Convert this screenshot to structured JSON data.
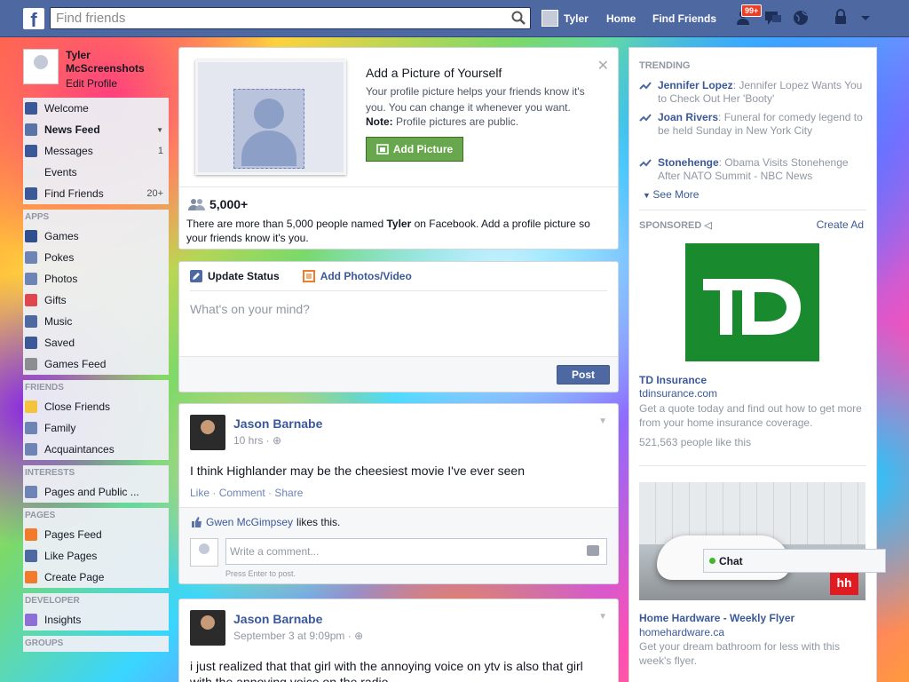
{
  "topbar": {
    "search_placeholder": "Find friends",
    "user_name": "Tyler",
    "home": "Home",
    "find_friends": "Find Friends",
    "notif_badge": "99+"
  },
  "left": {
    "profile_name": "Tyler McScreenshots",
    "edit_profile": "Edit Profile",
    "main": [
      {
        "label": "Welcome",
        "count": "",
        "color": "#3b5998"
      },
      {
        "label": "News Feed",
        "count": "",
        "color": "#5b74a8"
      },
      {
        "label": "Messages",
        "count": "1",
        "color": "#3b5998"
      },
      {
        "label": "Events",
        "count": "",
        "color": "#e9eaed"
      },
      {
        "label": "Find Friends",
        "count": "20+",
        "color": "#3b5998"
      }
    ],
    "apps_head": "APPS",
    "apps": [
      {
        "label": "Games",
        "color": "#2f4f8f"
      },
      {
        "label": "Pokes",
        "color": "#6d84b4"
      },
      {
        "label": "Photos",
        "color": "#6d84b4"
      },
      {
        "label": "Gifts",
        "color": "#e0464e"
      },
      {
        "label": "Music",
        "color": "#4e69a2"
      },
      {
        "label": "Saved",
        "color": "#3b5998"
      },
      {
        "label": "Games Feed",
        "color": "#8b8d91"
      }
    ],
    "friends_head": "FRIENDS",
    "friends": [
      {
        "label": "Close Friends",
        "color": "#f5c33b"
      },
      {
        "label": "Family",
        "color": "#6d84b4"
      },
      {
        "label": "Acquaintances",
        "color": "#6d84b4"
      }
    ],
    "interests_head": "INTERESTS",
    "interests": [
      {
        "label": "Pages and Public ...",
        "color": "#6d84b4"
      }
    ],
    "pages_head": "PAGES",
    "pages": [
      {
        "label": "Pages Feed",
        "color": "#f07c2b"
      },
      {
        "label": "Like Pages",
        "color": "#4e69a2"
      },
      {
        "label": "Create Page",
        "color": "#f07c2b"
      }
    ],
    "developer_head": "DEVELOPER",
    "developer": [
      {
        "label": "Insights",
        "color": "#8e6fd6"
      }
    ],
    "groups_head": "GROUPS"
  },
  "addpic": {
    "title": "Add a Picture of Yourself",
    "text": "Your profile picture helps your friends know it's you. You can change it whenever you want.",
    "note_label": "Note:",
    "note_text": " Profile pictures are public.",
    "button": "Add Picture",
    "count": "5,000+",
    "desc_before": "There are more than 5,000 people named ",
    "desc_name": "Tyler",
    "desc_after": " on Facebook. Add a profile picture so your friends know it's you."
  },
  "composer": {
    "tab_status": "Update Status",
    "tab_photos": "Add Photos/Video",
    "placeholder": "What's on your mind?",
    "post": "Post"
  },
  "posts": [
    {
      "author": "Jason Barnabe",
      "time": "10 hrs · ",
      "body": "I think Highlander may be the cheesiest movie I've ever seen",
      "like": "Like",
      "comment": "Comment",
      "share": "Share",
      "liker": "Gwen McGimpsey",
      "likes_text": " likes this.",
      "comment_placeholder": "Write a comment...",
      "hint": "Press Enter to post."
    },
    {
      "author": "Jason Barnabe",
      "time": "September 3 at 9:09pm · ",
      "body": "i just realized that that girl with the annoying voice on ytv is also that girl with the annoying voice on the radio"
    }
  ],
  "right": {
    "trending_head": "TRENDING",
    "trending": [
      {
        "name": "Jennifer Lopez",
        "text": ": Jennifer Lopez Wants You to Check Out Her 'Booty'"
      },
      {
        "name": "Joan Rivers",
        "text": ": Funeral for comedy legend to be held Sunday in New York City"
      },
      {
        "name": "Stonehenge",
        "text": ": Obama Visits Stonehenge After NATO Summit - NBC News"
      }
    ],
    "see_more": "See More",
    "sponsored_head": "SPONSORED",
    "create_ad": "Create Ad",
    "ads": [
      {
        "logo": "TD",
        "title": "TD Insurance",
        "url": "tdinsurance.com",
        "text": "Get a quote today and find out how to get more from your home insurance coverage.",
        "likes": "521,563 people like this"
      },
      {
        "logo": "hh",
        "title": "Home Hardware - Weekly Flyer",
        "url": "homehardware.ca",
        "text": "Get your dream bathroom for less with this week's flyer."
      }
    ]
  },
  "chat": {
    "label": "Chat"
  }
}
